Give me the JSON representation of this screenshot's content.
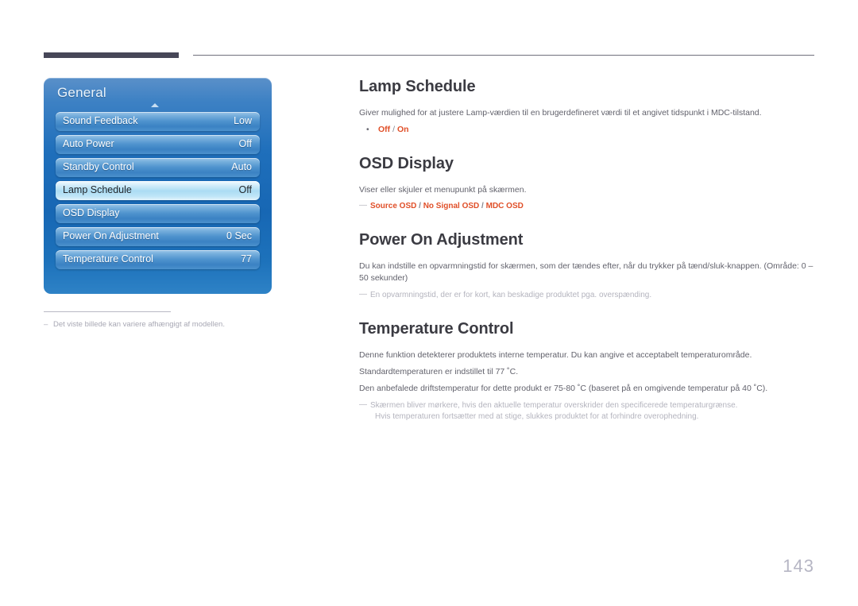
{
  "header": {
    "rule_accent_color": "#474758",
    "rule_line_color": "#6f6f7c"
  },
  "osd_menu": {
    "title": "General",
    "scroll_indicator": "up-arrow",
    "rows": [
      {
        "label": "Sound Feedback",
        "value": "Low",
        "selected": false
      },
      {
        "label": "Auto Power",
        "value": "Off",
        "selected": false
      },
      {
        "label": "Standby Control",
        "value": "Auto",
        "selected": false
      },
      {
        "label": "Lamp Schedule",
        "value": "Off",
        "selected": true
      },
      {
        "label": "OSD Display",
        "value": "",
        "selected": false
      },
      {
        "label": "Power On Adjustment",
        "value": "0 Sec",
        "selected": false
      },
      {
        "label": "Temperature Control",
        "value": "77",
        "selected": false
      }
    ]
  },
  "left_note": {
    "dash": "–",
    "text": "Det viste billede kan variere afhængigt af modellen."
  },
  "sections": [
    {
      "title": "Lamp Schedule",
      "body": [
        "Giver mulighed for at justere Lamp-værdien til en brugerdefineret værdi til et angivet tidspunkt i MDC-tilstand."
      ],
      "bullet": {
        "marker": "•",
        "option_1": "Off",
        "separator": "/",
        "option_2": "On"
      }
    },
    {
      "title": "OSD Display",
      "body": [
        "Viser eller skjuler et menupunkt på skærmen."
      ],
      "orange_note": {
        "dash": "—",
        "option_1": "Source OSD",
        "separator_1": "/",
        "option_2": "No Signal OSD",
        "separator_2": "/",
        "option_3": "MDC OSD"
      }
    },
    {
      "title": "Power On Adjustment",
      "body": [
        "Du kan indstille en opvarmningstid for skærmen, som der tændes efter, når du trykker på tænd/sluk-knappen. (Område: 0 – 50 sekunder)"
      ],
      "note": {
        "dash": "—",
        "text": "En opvarmningstid, der er for kort, kan beskadige produktet pga. overspænding."
      }
    },
    {
      "title": "Temperature Control",
      "body": [
        "Denne funktion detekterer produktets interne temperatur. Du kan angive et acceptabelt temperaturområde.",
        "Standardtemperaturen er indstillet til 77 ˚C.",
        "Den anbefalede driftstemperatur for dette produkt er 75-80 ˚C (baseret på en omgivende temperatur på 40 ˚C)."
      ],
      "note": {
        "dash": "—",
        "text": "Skærmen bliver mørkere, hvis den aktuelle temperatur overskrider den specificerede temperaturgrænse.",
        "text_cont": "Hvis temperaturen fortsætter med at stige, slukkes produktet for at forhindre overophedning."
      }
    }
  ],
  "page_number": "143"
}
